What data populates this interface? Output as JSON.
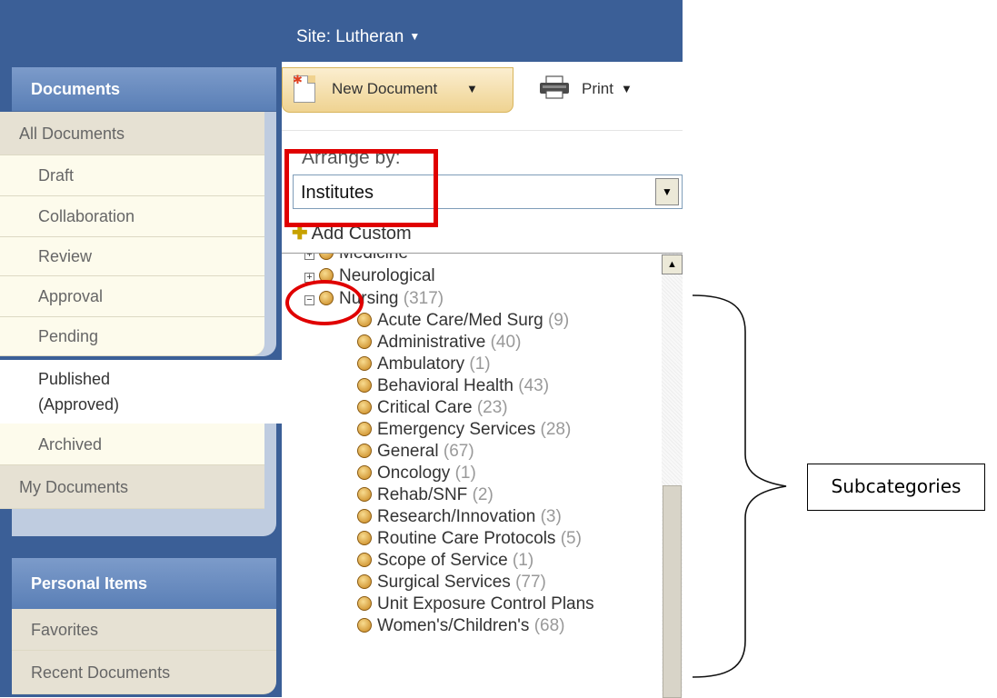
{
  "header": {
    "site_label": "Site: Lutheran"
  },
  "sidebar": {
    "documents_header": "Documents",
    "items": [
      {
        "label": "All Documents"
      },
      {
        "label": "Draft"
      },
      {
        "label": "Collaboration"
      },
      {
        "label": "Review"
      },
      {
        "label": "Approval"
      },
      {
        "label": "Pending"
      },
      {
        "label": "Published\n(Approved)",
        "selected": true
      },
      {
        "label": "Archived"
      },
      {
        "label": "My Documents"
      }
    ],
    "personal_header": "Personal Items",
    "personal_items": [
      {
        "label": "Favorites"
      },
      {
        "label": "Recent Documents"
      }
    ]
  },
  "toolbar": {
    "new_document_label": "New Document",
    "print_label": "Print"
  },
  "arrange": {
    "label": "Arrange by:",
    "selected": "Institutes",
    "add_custom_label": "Add Custom"
  },
  "tree": {
    "partial_top_label": "Medicine",
    "nodes": [
      {
        "label": "Neurological",
        "count": "",
        "expander": "+"
      },
      {
        "label": "Nursing",
        "count": "(317)",
        "expander": "−"
      }
    ],
    "children": [
      {
        "label": "Acute Care/Med Surg",
        "count": "(9)"
      },
      {
        "label": "Administrative",
        "count": "(40)"
      },
      {
        "label": "Ambulatory",
        "count": "(1)"
      },
      {
        "label": "Behavioral Health",
        "count": "(43)"
      },
      {
        "label": "Critical Care",
        "count": "(23)"
      },
      {
        "label": "Emergency Services",
        "count": "(28)"
      },
      {
        "label": "General",
        "count": "(67)"
      },
      {
        "label": "Oncology",
        "count": "(1)"
      },
      {
        "label": "Rehab/SNF",
        "count": "(2)"
      },
      {
        "label": "Research/Innovation",
        "count": "(3)"
      },
      {
        "label": "Routine Care Protocols",
        "count": "(5)"
      },
      {
        "label": "Scope of Service",
        "count": "(1)"
      },
      {
        "label": "Surgical Services",
        "count": "(77)"
      },
      {
        "label": "Unit Exposure Control Plans",
        "count": ""
      },
      {
        "label": "Women's/Children's",
        "count": "(68)"
      }
    ]
  },
  "annotation": {
    "callout_label": "Subcategories",
    "annotation_color": "#e00000"
  }
}
